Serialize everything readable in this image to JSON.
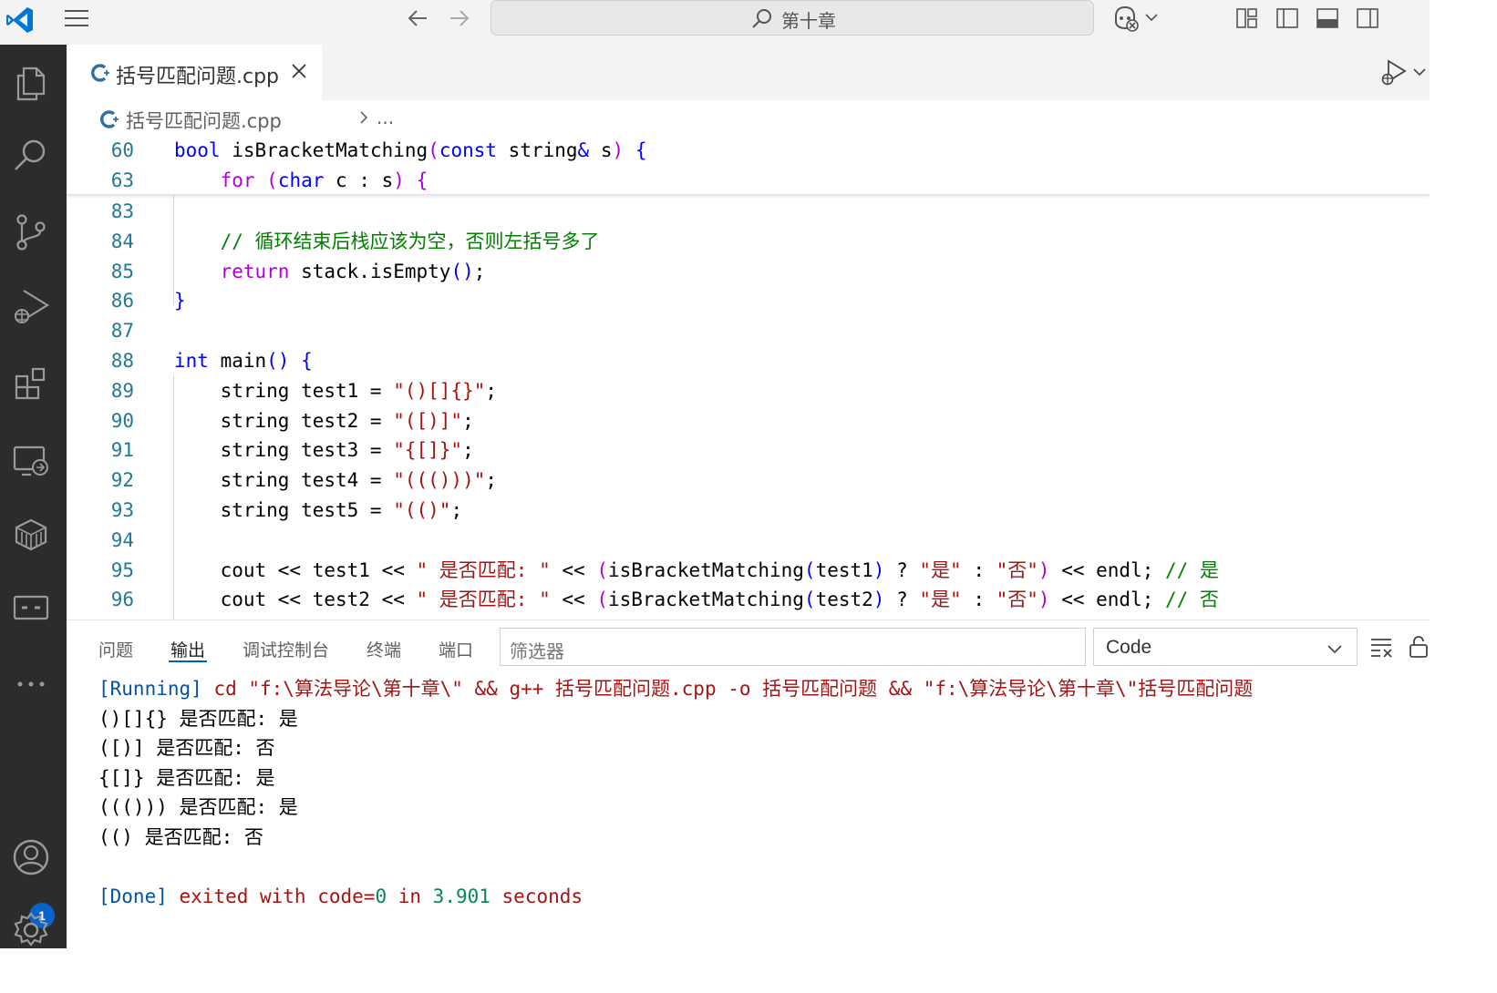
{
  "titlebar": {
    "search_text": "第十章"
  },
  "tab": {
    "filename": "括号匹配问题.cpp"
  },
  "breadcrumb": {
    "file": "括号匹配问题.cpp",
    "more": "..."
  },
  "sticky": [
    {
      "num": "60",
      "indent": "",
      "tokens": [
        [
          "kw",
          "bool"
        ],
        [
          "fn",
          " isBracketMatching"
        ],
        [
          "ctl",
          "("
        ],
        [
          "kw",
          "const"
        ],
        [
          "fn",
          " string"
        ],
        [
          "kw",
          "&"
        ],
        [
          "fn",
          " s"
        ],
        [
          "ctl",
          ")"
        ],
        [
          "fn",
          " "
        ],
        [
          "kw",
          "{"
        ]
      ]
    },
    {
      "num": "63",
      "indent": "    ",
      "tokens": [
        [
          "ctl",
          "for"
        ],
        [
          "fn",
          " "
        ],
        [
          "ctl",
          "("
        ],
        [
          "kw",
          "char"
        ],
        [
          "fn",
          " c : s"
        ],
        [
          "ctl",
          ")"
        ],
        [
          "fn",
          " "
        ],
        [
          "ctl",
          "{"
        ]
      ]
    }
  ],
  "lines": [
    {
      "num": "83",
      "tokens": []
    },
    {
      "num": "84",
      "tokens": [
        [
          "fn",
          "    "
        ],
        [
          "cm",
          "// 循环结束后栈应该为空，否则左括号多了"
        ]
      ]
    },
    {
      "num": "85",
      "tokens": [
        [
          "fn",
          "    "
        ],
        [
          "ctl",
          "return"
        ],
        [
          "fn",
          " stack.isEmpty"
        ],
        [
          "kw",
          "()"
        ],
        [
          "fn",
          ";"
        ]
      ]
    },
    {
      "num": "86",
      "tokens": [
        [
          "kw",
          "}"
        ]
      ]
    },
    {
      "num": "87",
      "tokens": []
    },
    {
      "num": "88",
      "tokens": [
        [
          "kw",
          "int"
        ],
        [
          "fn",
          " main"
        ],
        [
          "kw",
          "()"
        ],
        [
          "fn",
          " "
        ],
        [
          "kw",
          "{"
        ]
      ]
    },
    {
      "num": "89",
      "tokens": [
        [
          "fn",
          "    string test1 = "
        ],
        [
          "str",
          "\"()[]{}\""
        ],
        [
          "fn",
          ";"
        ]
      ]
    },
    {
      "num": "90",
      "tokens": [
        [
          "fn",
          "    string test2 = "
        ],
        [
          "str",
          "\"([)]\""
        ],
        [
          "fn",
          ";"
        ]
      ]
    },
    {
      "num": "91",
      "tokens": [
        [
          "fn",
          "    string test3 = "
        ],
        [
          "str",
          "\"{[]}\""
        ],
        [
          "fn",
          ";"
        ]
      ]
    },
    {
      "num": "92",
      "tokens": [
        [
          "fn",
          "    string test4 = "
        ],
        [
          "str",
          "\"((()))\""
        ],
        [
          "fn",
          ";"
        ]
      ]
    },
    {
      "num": "93",
      "tokens": [
        [
          "fn",
          "    string test5 = "
        ],
        [
          "str",
          "\"(()\""
        ],
        [
          "fn",
          ";"
        ]
      ]
    },
    {
      "num": "94",
      "tokens": []
    },
    {
      "num": "95",
      "tokens": [
        [
          "fn",
          "    cout << test1 << "
        ],
        [
          "str",
          "\" 是否匹配: \""
        ],
        [
          "fn",
          " << "
        ],
        [
          "ctl",
          "("
        ],
        [
          "fn",
          "isBracketMatching"
        ],
        [
          "kw",
          "("
        ],
        [
          "fn",
          "test1"
        ],
        [
          "kw",
          ")"
        ],
        [
          "fn",
          " ? "
        ],
        [
          "str",
          "\"是\""
        ],
        [
          "fn",
          " : "
        ],
        [
          "str",
          "\"否\""
        ],
        [
          "ctl",
          ")"
        ],
        [
          "fn",
          " << endl; "
        ],
        [
          "cm",
          "// 是"
        ]
      ]
    },
    {
      "num": "96",
      "tokens": [
        [
          "fn",
          "    cout << test2 << "
        ],
        [
          "str",
          "\" 是否匹配: \""
        ],
        [
          "fn",
          " << "
        ],
        [
          "ctl",
          "("
        ],
        [
          "fn",
          "isBracketMatching"
        ],
        [
          "kw",
          "("
        ],
        [
          "fn",
          "test2"
        ],
        [
          "kw",
          ")"
        ],
        [
          "fn",
          " ? "
        ],
        [
          "str",
          "\"是\""
        ],
        [
          "fn",
          " : "
        ],
        [
          "str",
          "\"否\""
        ],
        [
          "ctl",
          ")"
        ],
        [
          "fn",
          " << endl; "
        ],
        [
          "cm",
          "// 否"
        ]
      ]
    }
  ],
  "panel": {
    "tabs": [
      "问题",
      "输出",
      "调试控制台",
      "终端",
      "端口"
    ],
    "active_tab": "输出",
    "filter_placeholder": "筛选器",
    "channel": "Code",
    "output": [
      [
        [
          "info",
          "[Running]"
        ],
        [
          "str",
          " cd \"f:\\算法导论\\第十章\\\" && g++ 括号匹配问题.cpp -o 括号匹配问题 && \"f:\\算法导论\\第十章\\\"括号匹配问题"
        ]
      ],
      [
        [
          "plain",
          "()[]{} 是否匹配: 是"
        ]
      ],
      [
        [
          "plain",
          "([)] 是否匹配: 否"
        ]
      ],
      [
        [
          "plain",
          "{[]} 是否匹配: 是"
        ]
      ],
      [
        [
          "plain",
          "((())) 是否匹配: 是"
        ]
      ],
      [
        [
          "plain",
          "(() 是否匹配: 否"
        ]
      ],
      [],
      [
        [
          "info",
          "[Done]"
        ],
        [
          "str",
          " exited with code="
        ],
        [
          "num",
          "0"
        ],
        [
          "str",
          " in "
        ],
        [
          "num",
          "3.901"
        ],
        [
          "str",
          " seconds"
        ]
      ]
    ]
  },
  "accounts_badge": "1",
  "colors": {
    "accent": "#005fb8",
    "activity_bar": "#2c2c2c",
    "keyword": "#0000ff",
    "control": "#af00db",
    "string": "#a31515",
    "comment": "#008000",
    "line_number": "#237893"
  }
}
